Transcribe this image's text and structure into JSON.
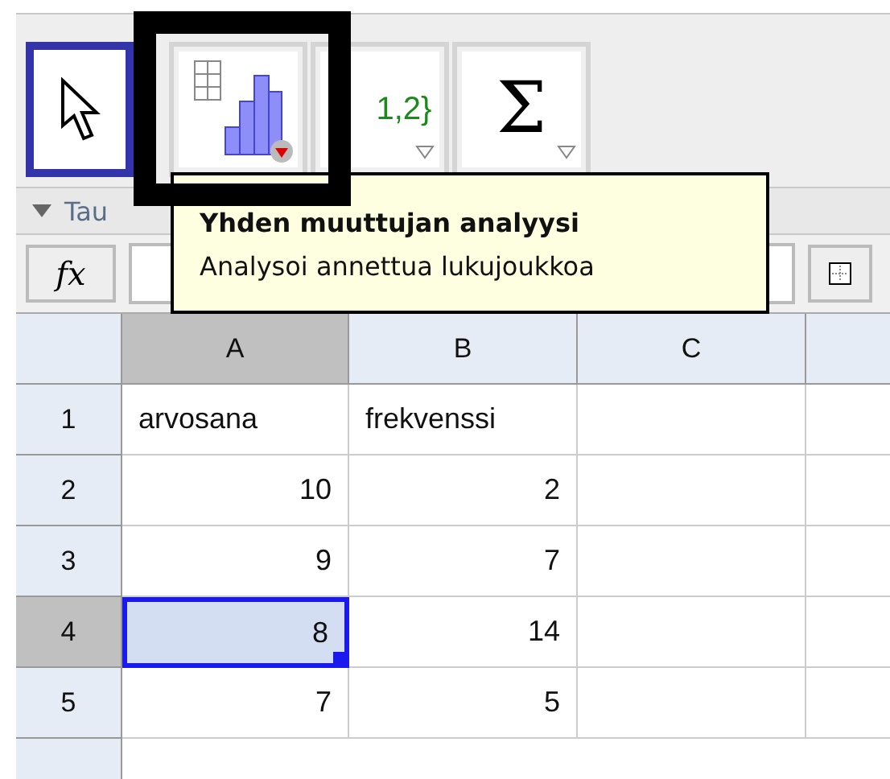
{
  "toolbar": {
    "tools": [
      {
        "kind": "pointer",
        "selected": true
      },
      {
        "kind": "histogram",
        "selected": false
      },
      {
        "kind": "list",
        "label": "1,2}",
        "selected": false
      },
      {
        "kind": "sigma",
        "label": "Σ",
        "selected": false
      }
    ]
  },
  "view_title": "Tau",
  "tooltip": {
    "title": "Yhden muuttujan analyysi",
    "text": "Analysoi annettua lukujoukkoa"
  },
  "input_bar": {
    "button": "fx"
  },
  "spreadsheet": {
    "columns": [
      {
        "label": "A",
        "selected": true
      },
      {
        "label": "B",
        "selected": false
      },
      {
        "label": "C",
        "selected": false
      }
    ],
    "rows": [
      {
        "label": "1",
        "selected": false,
        "cells": [
          {
            "text": "arvosana",
            "kind": "text",
            "selected": false
          },
          {
            "text": "frekvenssi",
            "kind": "text",
            "selected": false
          }
        ]
      },
      {
        "label": "2",
        "selected": false,
        "cells": [
          {
            "text": "10",
            "kind": "number",
            "selected": false
          },
          {
            "text": "2",
            "kind": "number",
            "selected": false
          }
        ]
      },
      {
        "label": "3",
        "selected": false,
        "cells": [
          {
            "text": "9",
            "kind": "number",
            "selected": false
          },
          {
            "text": "7",
            "kind": "number",
            "selected": false
          }
        ]
      },
      {
        "label": "4",
        "selected": true,
        "cells": [
          {
            "text": "8",
            "kind": "number",
            "selected": true
          },
          {
            "text": "14",
            "kind": "number",
            "selected": false
          }
        ]
      },
      {
        "label": "5",
        "selected": false,
        "cells": [
          {
            "text": "7",
            "kind": "number",
            "selected": false
          },
          {
            "text": "5",
            "kind": "number",
            "selected": false
          }
        ]
      }
    ]
  }
}
